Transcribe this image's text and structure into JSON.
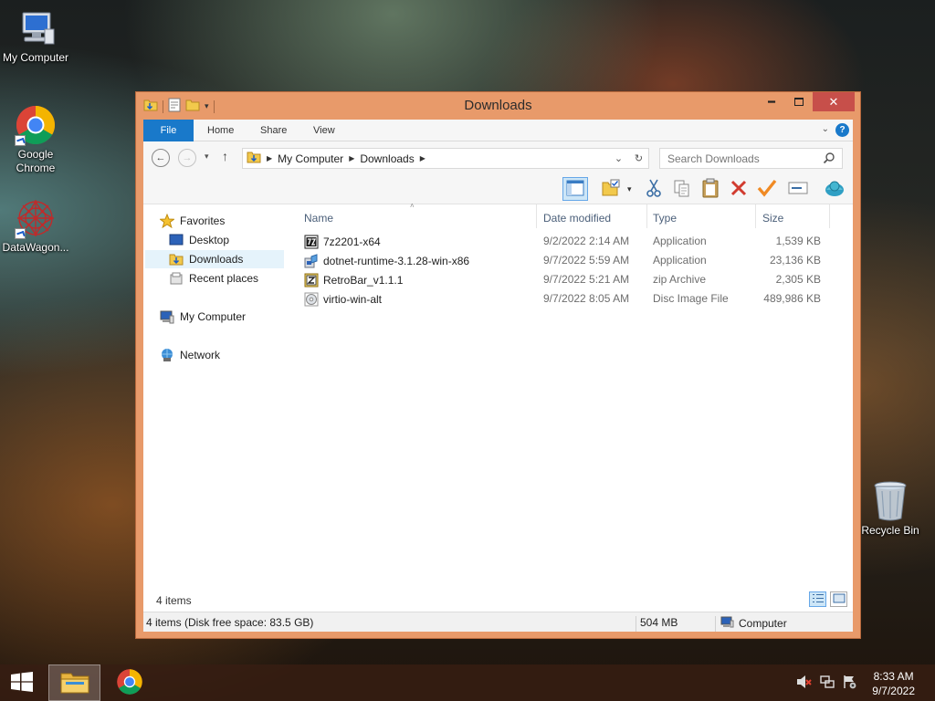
{
  "desktop": {
    "icons": [
      {
        "label": "My Computer"
      },
      {
        "label": "Google Chrome"
      },
      {
        "label": "DataWagon..."
      },
      {
        "label": "Recycle Bin"
      }
    ]
  },
  "window": {
    "title": "Downloads",
    "ribbon_tabs": [
      "File",
      "Home",
      "Share",
      "View"
    ],
    "help_label": "?",
    "address": {
      "crumbs": [
        "My Computer",
        "Downloads"
      ]
    },
    "search_placeholder": "Search Downloads",
    "nav_pane": {
      "favorites": "Favorites",
      "desktop": "Desktop",
      "downloads": "Downloads",
      "recent": "Recent places",
      "computer": "My Computer",
      "network": "Network"
    },
    "columns": [
      "Name",
      "Date modified",
      "Type",
      "Size"
    ],
    "files": [
      {
        "name": "7z2201-x64",
        "date": "9/2/2022 2:14 AM",
        "type": "Application",
        "size": "1,539 KB",
        "icon": "7zip-installer-icon"
      },
      {
        "name": "dotnet-runtime-3.1.28-win-x86",
        "date": "9/7/2022 5:59 AM",
        "type": "Application",
        "size": "23,136 KB",
        "icon": "installer-icon"
      },
      {
        "name": "RetroBar_v1.1.1",
        "date": "9/7/2022 5:21 AM",
        "type": "zip Archive",
        "size": "2,305 KB",
        "icon": "zip-archive-icon"
      },
      {
        "name": "virtio-win-alt",
        "date": "9/7/2022 8:05 AM",
        "type": "Disc Image File",
        "size": "489,986 KB",
        "icon": "disc-image-icon"
      }
    ],
    "item_count": "4 items",
    "status": {
      "left": "4 items (Disk free space: 83.5 GB)",
      "size": "504 MB",
      "location": "Computer"
    }
  },
  "taskbar": {
    "time": "8:33 AM",
    "date": "9/7/2022"
  },
  "colors": {
    "window_frame": "#e89a6a",
    "close_button": "#c74f4a",
    "file_tab": "#1979ca",
    "selection": "#cde6f7"
  }
}
